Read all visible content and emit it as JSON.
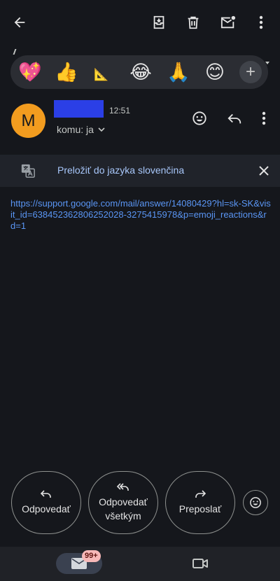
{
  "colors": {
    "background": "#15171c",
    "accent_link": "#5a96f5",
    "avatar": "#f29c1f",
    "redaction": "#2b3fe6",
    "badge": "#f7b8b8"
  },
  "toolbar": {
    "back_icon": "arrow-back-icon",
    "archive_icon": "archive-icon",
    "delete_icon": "trash-icon",
    "mark_unread_icon": "mail-unread-icon",
    "more_icon": "more-vert-icon"
  },
  "reactions": {
    "emojis": [
      "💖",
      "👍",
      "📐",
      "😂",
      "🙏",
      "😊"
    ],
    "add_label": "+"
  },
  "message": {
    "avatar_letter": "M",
    "time": "12:51",
    "to_label": "komu: ja"
  },
  "translate": {
    "label": "Preložiť do jazyka slovenčina"
  },
  "body": {
    "link": "https://support.google.com/mail/answer/14080429?hl=sk-SK&visit_id=638452362806252028-3275415978&p=emoji_reactions&rd=1"
  },
  "quick_reply": {
    "reply": "Odpovedať",
    "reply_all_line1": "Odpovedať",
    "reply_all_line2": "všetkým",
    "forward": "Preposlať"
  },
  "bottom_nav": {
    "mail_badge": "99+"
  }
}
